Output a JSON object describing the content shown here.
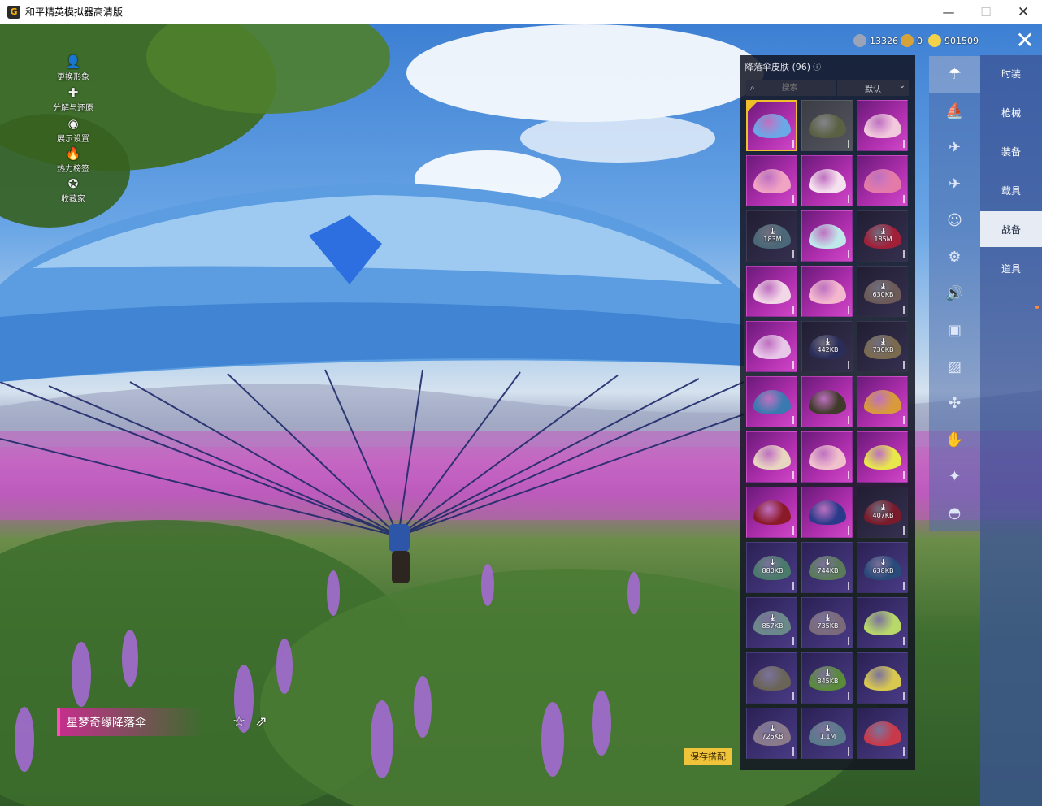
{
  "window": {
    "title": "和平精英模拟器高清版",
    "logo_letter": "G",
    "min_glyph": "—",
    "max_glyph": "☐",
    "close_glyph": "✕"
  },
  "tools": [
    {
      "icon": "person-icon",
      "glyph": "👤",
      "label": "更换形象"
    },
    {
      "icon": "puzzle-icon",
      "glyph": "✚",
      "label": "分解与还原"
    },
    {
      "icon": "eye-icon",
      "glyph": "◉",
      "label": "展示设置"
    },
    {
      "icon": "flame-icon",
      "glyph": "🔥",
      "label": "热力榜签"
    },
    {
      "icon": "badge-icon",
      "glyph": "✪",
      "label": "收藏家"
    }
  ],
  "currencies": [
    {
      "icon": "silver-coin-icon",
      "value": "13326",
      "color": "#9aa3b8"
    },
    {
      "icon": "gold-c-coin-icon",
      "value": "0",
      "color": "#d8a23a"
    },
    {
      "icon": "diamond-coin-icon",
      "value": "901509",
      "color": "#f3d24a"
    }
  ],
  "close_glyph": "✕",
  "panel": {
    "title": "降落伞皮肤 (96)",
    "info_glyph": "ⓘ",
    "search_icon_glyph": "⌕",
    "search_placeholder": "搜索",
    "sort_value": "默认",
    "sort_chevron": "⌄"
  },
  "skins": [
    {
      "rarity": "pink",
      "color": "#6aa8e6",
      "download": "",
      "selected": true
    },
    {
      "rarity": "gray",
      "color": "#5a6043",
      "download": ""
    },
    {
      "rarity": "pink",
      "color": "#f1c9dc",
      "download": ""
    },
    {
      "rarity": "pink",
      "color": "#f0a3c2",
      "download": ""
    },
    {
      "rarity": "pink",
      "color": "#f6e2ee",
      "download": ""
    },
    {
      "rarity": "pink",
      "color": "#e47aa8",
      "download": ""
    },
    {
      "rarity": "dark",
      "color": "#4a6878",
      "download": "183M"
    },
    {
      "rarity": "pink",
      "color": "#bfe8ea",
      "download": ""
    },
    {
      "rarity": "dark",
      "color": "#a0203a",
      "download": "185M"
    },
    {
      "rarity": "pink",
      "color": "#f2d8e6",
      "download": ""
    },
    {
      "rarity": "pink",
      "color": "#f4b8ce",
      "download": ""
    },
    {
      "rarity": "dark",
      "color": "#6b5a58",
      "download": "630KB"
    },
    {
      "rarity": "pink",
      "color": "#e8c8e8",
      "download": ""
    },
    {
      "rarity": "dark",
      "color": "#2a2c5a",
      "download": "442KB"
    },
    {
      "rarity": "dark",
      "color": "#7a6a50",
      "download": "730KB"
    },
    {
      "rarity": "pink",
      "color": "#3a7ab0",
      "download": ""
    },
    {
      "rarity": "pink",
      "color": "#3f3a2a",
      "download": ""
    },
    {
      "rarity": "pink",
      "color": "#d89a3a",
      "download": ""
    },
    {
      "rarity": "pink",
      "color": "#e8d6c0",
      "download": ""
    },
    {
      "rarity": "pink",
      "color": "#f0c0cc",
      "download": ""
    },
    {
      "rarity": "pink",
      "color": "#e8e84a",
      "download": ""
    },
    {
      "rarity": "pink",
      "color": "#8a1a28",
      "download": ""
    },
    {
      "rarity": "pink",
      "color": "#2a3a8a",
      "download": ""
    },
    {
      "rarity": "dark",
      "color": "#7a1a2a",
      "download": "407KB"
    },
    {
      "rarity": "purple",
      "color": "#4a7a6a",
      "download": "880KB"
    },
    {
      "rarity": "purple",
      "color": "#5a7a5a",
      "download": "744KB"
    },
    {
      "rarity": "purple",
      "color": "#2a4a7a",
      "download": "638KB"
    },
    {
      "rarity": "purple",
      "color": "#6a8a8a",
      "download": "857KB"
    },
    {
      "rarity": "purple",
      "color": "#7a6a7a",
      "download": "735KB"
    },
    {
      "rarity": "purple",
      "color": "#b8d86a",
      "download": ""
    },
    {
      "rarity": "purple",
      "color": "#6a6458",
      "download": ""
    },
    {
      "rarity": "purple",
      "color": "#5a8a3a",
      "download": "845KB"
    },
    {
      "rarity": "purple",
      "color": "#d8c850",
      "download": ""
    },
    {
      "rarity": "purple",
      "color": "#8a7a8a",
      "download": "725KB"
    },
    {
      "rarity": "purple",
      "color": "#5a7a8a",
      "download": "1.1M"
    },
    {
      "rarity": "purple",
      "color": "#c83a4a",
      "download": ""
    }
  ],
  "download_glyph": "⤓",
  "icon_column": [
    {
      "icon": "parachute-icon",
      "glyph": "☂",
      "active": true
    },
    {
      "icon": "boat-icon",
      "glyph": "⛵"
    },
    {
      "icon": "drone-icon",
      "glyph": "✈"
    },
    {
      "icon": "plane-icon",
      "glyph": "✈"
    },
    {
      "icon": "face-icon",
      "glyph": "☺"
    },
    {
      "icon": "robot-icon",
      "glyph": "⚙"
    },
    {
      "icon": "speaker-icon",
      "glyph": "🔊"
    },
    {
      "icon": "box-icon",
      "glyph": "▣"
    },
    {
      "icon": "picture-icon",
      "glyph": "▨"
    },
    {
      "icon": "spray-icon",
      "glyph": "✣"
    },
    {
      "icon": "hand-icon",
      "glyph": "✋"
    },
    {
      "icon": "wand-icon",
      "glyph": "✦"
    },
    {
      "icon": "hat-icon",
      "glyph": "◓"
    }
  ],
  "categories": [
    {
      "label": "时装"
    },
    {
      "label": "枪械"
    },
    {
      "label": "装备"
    },
    {
      "label": "载具"
    },
    {
      "label": "战备",
      "active": true
    },
    {
      "label": "道具"
    }
  ],
  "item_name": "星梦奇缘降落伞",
  "favorite_glyph": "☆",
  "share_glyph": "⇗",
  "save_label": "保存搭配"
}
